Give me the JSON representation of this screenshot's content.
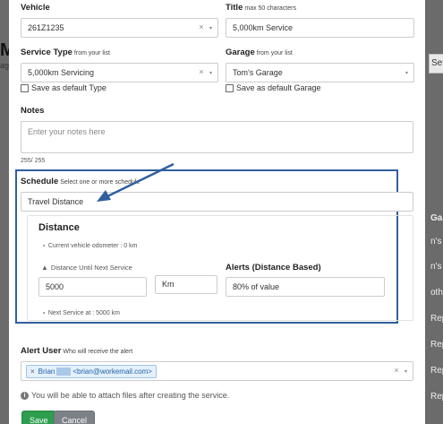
{
  "background": {
    "left_heading": "M",
    "left_sub": "ag",
    "right_button": "Set",
    "right_column": "Gara",
    "right_cells": [
      "n's G",
      "n's G",
      "othsid",
      "Rep",
      "Rep",
      "Rep",
      "Rep"
    ]
  },
  "form": {
    "vehicle": {
      "label": "Vehicle",
      "value": "261Z1235"
    },
    "title": {
      "label": "Title",
      "hint": "max 50 characters",
      "value": "5,000km Service"
    },
    "service_type": {
      "label": "Service Type",
      "hint": "from your list",
      "value": "5,000km Servicing",
      "default_label": "Save as default Type"
    },
    "garage": {
      "label": "Garage",
      "hint": "from your list",
      "value": "Tom's Garage",
      "default_label": "Save as default Garage"
    },
    "notes": {
      "label": "Notes",
      "placeholder": "Enter your notes here",
      "counter": "255/ 255"
    },
    "schedule": {
      "label": "Schedule",
      "hint": "Select one or more schedule",
      "value": "Travel Distance"
    },
    "distance": {
      "heading": "Distance",
      "odometer": "Current vehicle odometer : 0 km",
      "until_label": "Distance Until Next Service",
      "until_value": "5000",
      "unit": "Km",
      "alerts_label": "Alerts (Distance Based)",
      "alerts_value": "80% of value",
      "next_service": "Next Service at : 5000 km"
    },
    "alert_user": {
      "label": "Alert User",
      "hint": "Who will receive the alert",
      "tag_name": "Brian",
      "tag_email": "<brian@workemail.com>"
    },
    "info": "You will be able to attach files after creating the service.",
    "save_label": "Save",
    "cancel_label": "Cancel"
  },
  "colors": {
    "highlight_border": "#2f5f9f",
    "arrow": "#2f5f9f",
    "save_button": "#2e9e4f",
    "cancel_button": "#7d8288"
  },
  "icons": [
    "clear-icon",
    "chevron-down-icon",
    "odometer-icon",
    "road-icon",
    "info-icon"
  ]
}
